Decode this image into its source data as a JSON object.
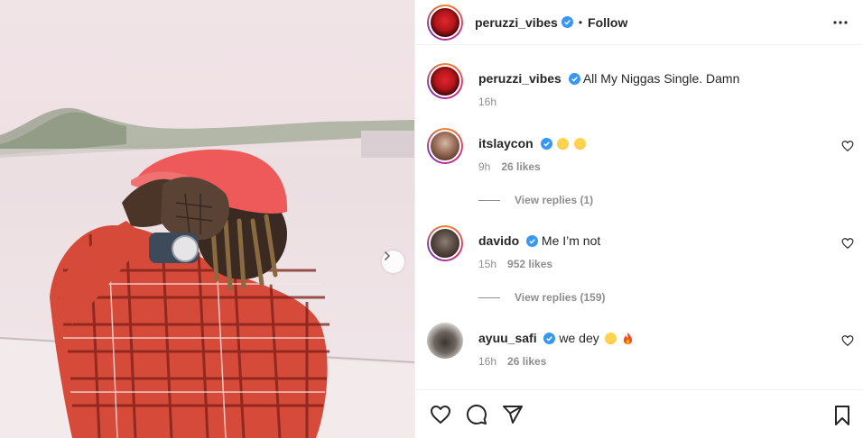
{
  "post": {
    "author": "peruzzi_vibes",
    "separator": "•",
    "follow_label": "Follow",
    "caption": "All My Niggas Single. Damn",
    "caption_time": "16h"
  },
  "comments": [
    {
      "username": "itslaycon",
      "text": "",
      "emoji": [
        "crying-emoji",
        "crying-emoji"
      ],
      "time": "9h",
      "likes": "26 likes",
      "replies": "View replies (1)"
    },
    {
      "username": "davido",
      "text": "Me I’m not",
      "emoji": [],
      "time": "15h",
      "likes": "952 likes",
      "replies": "View replies (159)"
    },
    {
      "username": "ayuu_safi",
      "text": "we dey",
      "emoji": [
        "laughing-emoji",
        "fire-emoji"
      ],
      "time": "16h",
      "likes": "26 likes",
      "replies": ""
    }
  ],
  "colors": {
    "verified": "#3897f0",
    "muted": "#8e8e8e",
    "text": "#262626",
    "border": "#efefef"
  },
  "icons": [
    "more-icon",
    "heart-icon",
    "comment-icon",
    "share-icon",
    "bookmark-icon",
    "chevron-right-icon",
    "verified-badge-icon"
  ]
}
